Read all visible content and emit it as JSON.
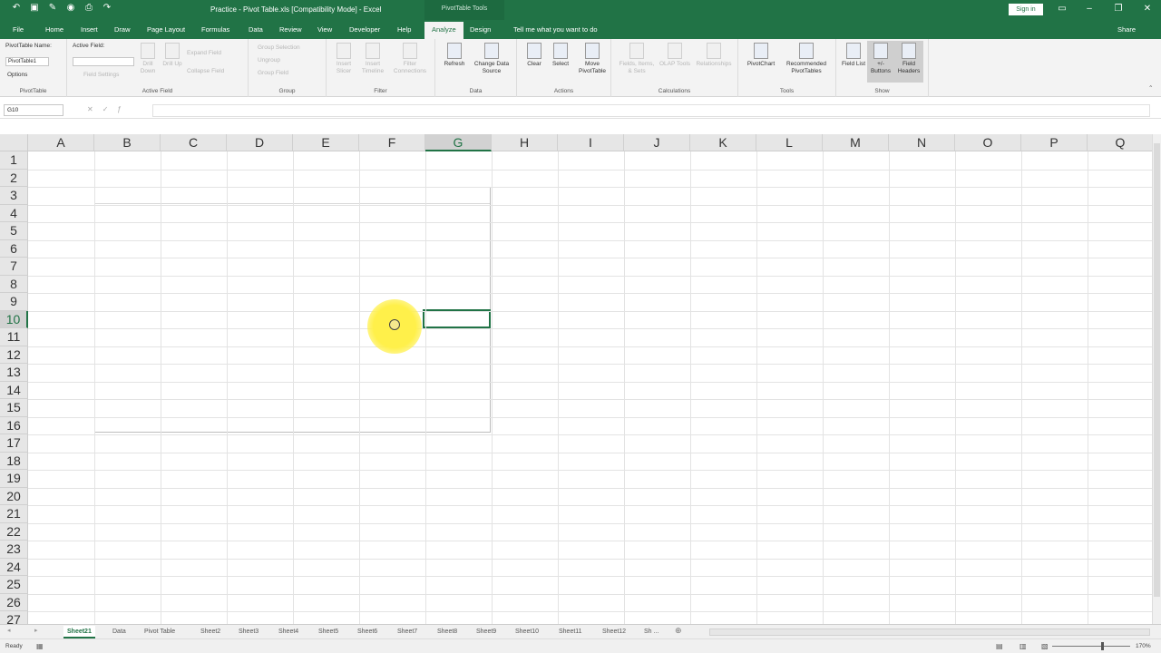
{
  "titlebar": {
    "title": "Practice - Pivot Table.xls [Compatibility Mode] - Excel",
    "context_tab": "PivotTable Tools",
    "signin": "Sign in"
  },
  "tabs": [
    "File",
    "Home",
    "Insert",
    "Draw",
    "Page Layout",
    "Formulas",
    "Data",
    "Review",
    "View",
    "Developer",
    "Help",
    "Analyze",
    "Design"
  ],
  "active_tab": "Analyze",
  "tell_me": "Tell me what you want to do",
  "share": "Share",
  "ribbon": {
    "pivottable": {
      "label_name": "PivotTable Name:",
      "value": "PivotTable1",
      "options": "Options",
      "group": "PivotTable"
    },
    "active_field": {
      "label": "Active Field:",
      "field_settings": "Field Settings",
      "drill_down": "Drill Down",
      "drill_up": "Drill Up",
      "expand": "Expand Field",
      "collapse": "Collapse Field",
      "group": "Active Field"
    },
    "group": {
      "group_selection": "Group Selection",
      "ungroup": "Ungroup",
      "group_field": "Group Field",
      "group": "Group"
    },
    "filter": {
      "insert_slicer": "Insert Slicer",
      "insert_timeline": "Insert Timeline",
      "filter_connections": "Filter Connections",
      "group": "Filter"
    },
    "data": {
      "refresh": "Refresh",
      "change_source": "Change Data Source",
      "group": "Data"
    },
    "actions": {
      "clear": "Clear",
      "select": "Select",
      "move": "Move PivotTable",
      "group": "Actions"
    },
    "calculations": {
      "fields": "Fields, Items, & Sets",
      "olap": "OLAP Tools",
      "relationships": "Relationships",
      "group": "Calculations"
    },
    "tools": {
      "pivotchart": "PivotChart",
      "recommended": "Recommended PivotTables",
      "group": "Tools"
    },
    "show": {
      "field_list": "Field List",
      "buttons": "+/- Buttons",
      "headers": "Field Headers",
      "group": "Show"
    }
  },
  "formula_bar": {
    "name_box": "G10",
    "formula": ""
  },
  "columns": [
    "A",
    "B",
    "C",
    "D",
    "E",
    "F",
    "G",
    "H",
    "I",
    "J",
    "K",
    "L",
    "M",
    "N",
    "O",
    "P",
    "Q"
  ],
  "selected_column": "G",
  "rows": [
    "1",
    "2",
    "3",
    "4",
    "5",
    "6",
    "7",
    "8",
    "9",
    "10",
    "11",
    "12",
    "13",
    "14",
    "15",
    "16",
    "17",
    "18",
    "19",
    "20",
    "21",
    "22",
    "23",
    "24",
    "25",
    "26",
    "27"
  ],
  "selected_row": "10",
  "sheets": [
    "Sheet21",
    "Data",
    "Pivot Table",
    "Sheet2",
    "Sheet3",
    "Sheet4",
    "Sheet5",
    "Sheet6",
    "Sheet7",
    "Sheet8",
    "Sheet9",
    "Sheet10",
    "Sheet11",
    "Sheet12",
    "Sh ..."
  ],
  "active_sheet": "Sheet21",
  "status": {
    "ready": "Ready",
    "zoom": "170%"
  },
  "colors": {
    "accent": "#217346",
    "highlight": "#fff04a"
  }
}
